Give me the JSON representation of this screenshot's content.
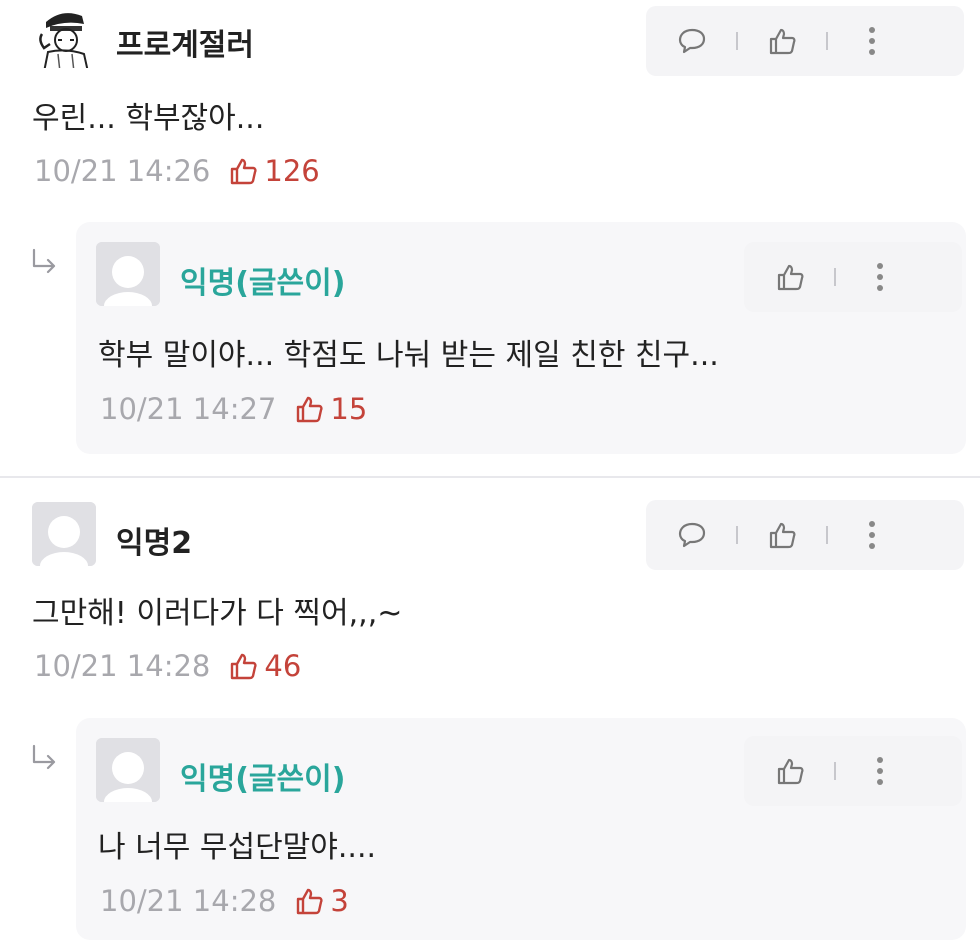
{
  "comments": [
    {
      "author": "프로계절러",
      "content": "우린... 학부잖아...",
      "time": "10/21 14:26",
      "likes": "126",
      "avatar_icon": "police-officer-avatar",
      "reply": {
        "author": "익명(글쓴이)",
        "content": "학부 말이야... 학점도 나눠 받는 제일 친한 친구...",
        "time": "10/21 14:27",
        "likes": "15"
      }
    },
    {
      "author": "익명2",
      "content": "그만해! 이러다가 다 찍어,,,~",
      "time": "10/21 14:28",
      "likes": "46",
      "avatar_icon": "default-avatar",
      "reply": {
        "author": "익명(글쓴이)",
        "content": "나 너무 무섭단말야....",
        "time": "10/21 14:28",
        "likes": "3"
      }
    }
  ],
  "colors": {
    "accent_author": "#2aa69b",
    "like_color": "#c4433a",
    "meta_gray": "#a8a8ad",
    "pill_bg": "#f4f4f6",
    "reply_bg": "#f7f7f9"
  },
  "icons": [
    "comment-icon",
    "thumbs-up-icon",
    "more-vertical-icon",
    "reply-arrow-icon"
  ]
}
